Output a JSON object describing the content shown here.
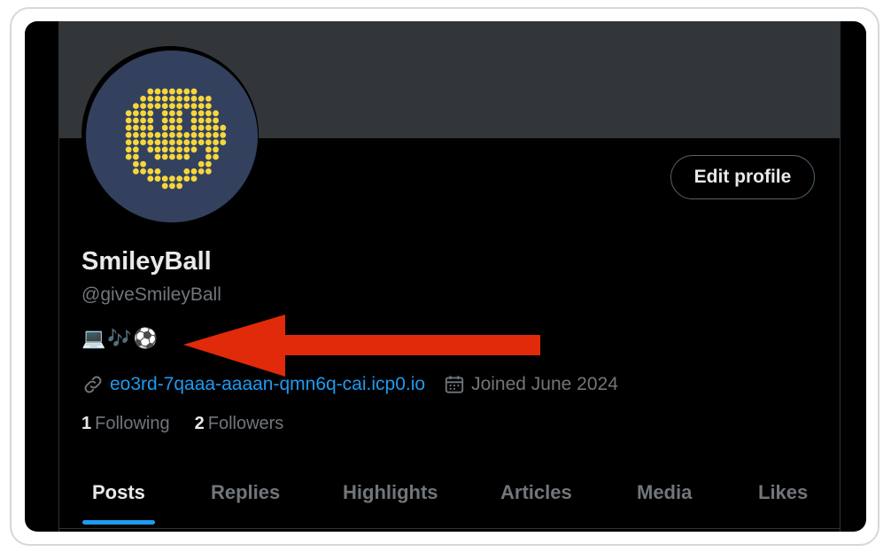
{
  "profile": {
    "name": "SmileyBall",
    "handle": "@giveSmileyBall",
    "bio_emojis": [
      "💻",
      "🎶",
      "⚽"
    ],
    "website": "eo3rd-7qaaa-aaaan-qmn6q-cai.icp0.io",
    "joined": "Joined June 2024",
    "following_count": "1",
    "following_label": "Following",
    "followers_count": "2",
    "followers_label": "Followers"
  },
  "header": {
    "edit_profile_label": "Edit profile"
  },
  "tabs": [
    {
      "label": "Posts",
      "active": true
    },
    {
      "label": "Replies",
      "active": false
    },
    {
      "label": "Highlights",
      "active": false
    },
    {
      "label": "Articles",
      "active": false
    },
    {
      "label": "Media",
      "active": false
    },
    {
      "label": "Likes",
      "active": false
    }
  ],
  "icons": {
    "link": "link-icon",
    "calendar": "calendar-icon"
  },
  "colors": {
    "background": "#000000",
    "banner": "#333639",
    "avatar_bg": "#33415f",
    "smiley": "#f6d73a",
    "accent": "#1d9bf0",
    "secondary_text": "#71767b",
    "annotation_arrow": "#e02a0a"
  }
}
